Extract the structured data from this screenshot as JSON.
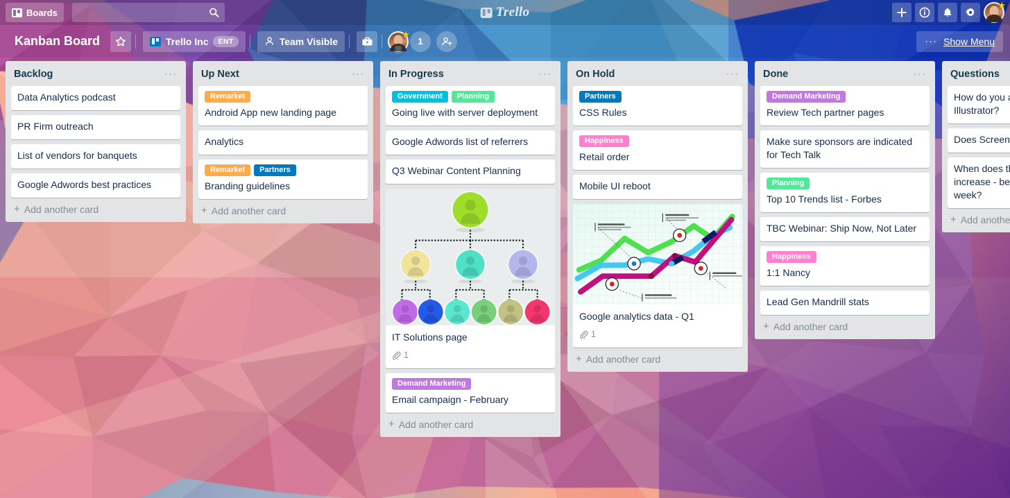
{
  "topbar": {
    "boards_label": "Boards",
    "boards_icon": "boards-grid-icon",
    "search_placeholder": "",
    "search_value": "",
    "search_icon": "search-icon",
    "brand": "Trello",
    "icons": [
      "plus-icon",
      "info-icon",
      "bell-icon",
      "gear-icon"
    ],
    "add_label": "+",
    "info_label": "i",
    "notifications_label": "",
    "settings_label": ""
  },
  "boardbar": {
    "title": "Kanban Board",
    "star_icon": "star-outline-icon",
    "org_name": "Trello Inc",
    "org_tag": "ENT",
    "visibility": "Team Visible",
    "visibility_icon": "person-outline-icon",
    "briefcase_icon": "briefcase-icon",
    "member_count": "1",
    "add_member_icon": "add-person-icon",
    "menu_dots": "···",
    "show_menu_label": "Show Menu"
  },
  "add_card_label": "Add another card",
  "list_menu_dots": "···",
  "label_colors": {
    "Remarket": "#ffab4a",
    "Partners": "#0079bf",
    "Government": "#00c2e0",
    "Planning": "#51e898",
    "Happiness": "#ff80ce",
    "Demand Marketing": "#c377e0"
  },
  "lists": [
    {
      "title": "Backlog",
      "cards": [
        {
          "title": "Data Analytics podcast",
          "labels": []
        },
        {
          "title": "PR Firm outreach",
          "labels": []
        },
        {
          "title": "List of vendors for banquets",
          "labels": []
        },
        {
          "title": "Google Adwords best practices",
          "labels": []
        }
      ]
    },
    {
      "title": "Up Next",
      "cards": [
        {
          "title": "Android App new landing page",
          "labels": [
            "Remarket"
          ]
        },
        {
          "title": "Analytics",
          "labels": []
        },
        {
          "title": "Branding guidelines",
          "labels": [
            "Remarket",
            "Partners"
          ]
        }
      ]
    },
    {
      "title": "In Progress",
      "cards": [
        {
          "title": "Going live with server deployment",
          "labels": [
            "Government",
            "Planning"
          ]
        },
        {
          "title": "Google Adwords list of referrers",
          "labels": []
        },
        {
          "title": "Q3 Webinar Content Planning",
          "labels": []
        },
        {
          "title": "IT Solutions page",
          "labels": [],
          "cover": "org-chart",
          "attachments": "1"
        },
        {
          "title": "Email campaign - February",
          "labels": [
            "Demand Marketing"
          ]
        }
      ]
    },
    {
      "title": "On Hold",
      "cards": [
        {
          "title": "CSS Rules",
          "labels": [
            "Partners"
          ]
        },
        {
          "title": "Retail order",
          "labels": [
            "Happiness"
          ]
        },
        {
          "title": "Mobile UI reboot",
          "labels": []
        },
        {
          "title": "Google analytics data - Q1",
          "labels": [],
          "cover": "line-chart",
          "attachments": "1"
        }
      ]
    },
    {
      "title": "Done",
      "cards": [
        {
          "title": "Review Tech partner pages",
          "labels": [
            "Demand Marketing"
          ]
        },
        {
          "title": "Make sure sponsors are indicated for Tech Talk",
          "labels": []
        },
        {
          "title": "Top 10 Trends list - Forbes",
          "labels": [
            "Planning"
          ]
        },
        {
          "title": "TBC Webinar: Ship Now, Not Later",
          "labels": []
        },
        {
          "title": "1:1 Nancy",
          "labels": [
            "Happiness"
          ]
        },
        {
          "title": "Lead Gen Mandrill stats",
          "labels": []
        }
      ]
    },
    {
      "title": "Questions",
      "cards": [
        {
          "title": "How do you add a brush in Illustrator?",
          "labels": []
        },
        {
          "title": "Does Screenhero work on Linux?",
          "labels": []
        },
        {
          "title": "When does the hosting cost increase - before or after launch week?",
          "labels": []
        }
      ]
    }
  ]
}
